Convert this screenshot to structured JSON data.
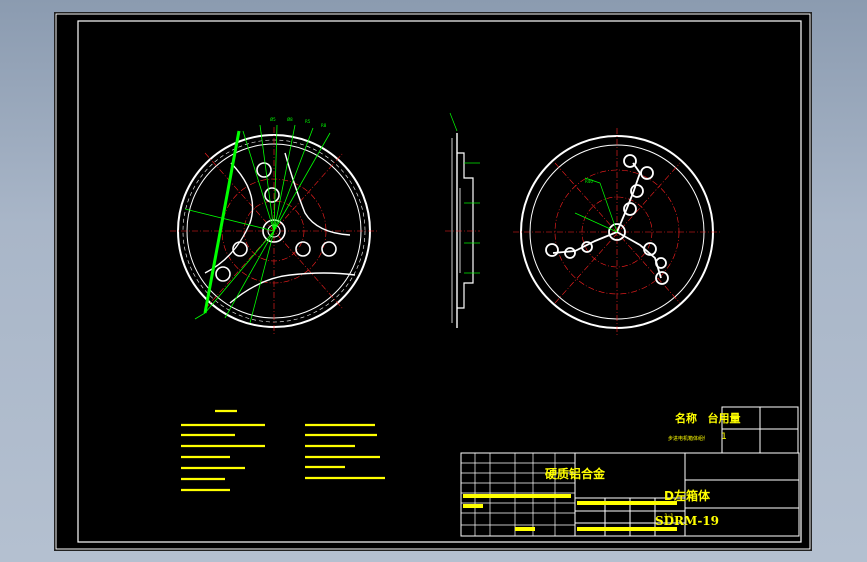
{
  "title_block": {
    "material": "硬质铝合金",
    "part_name": "D左箱体",
    "drawing_no": "SDRM-19",
    "scale": "1:1",
    "header_name": "名称",
    "header_qty": "台用量",
    "row_desc": "步进电机箱体组件",
    "row_qty": "1"
  },
  "colors": {
    "background": "#000000",
    "outline": "#ffffff",
    "dimension": "#00ff00",
    "centerline": "#ff2020",
    "notes": "#ffff00"
  }
}
